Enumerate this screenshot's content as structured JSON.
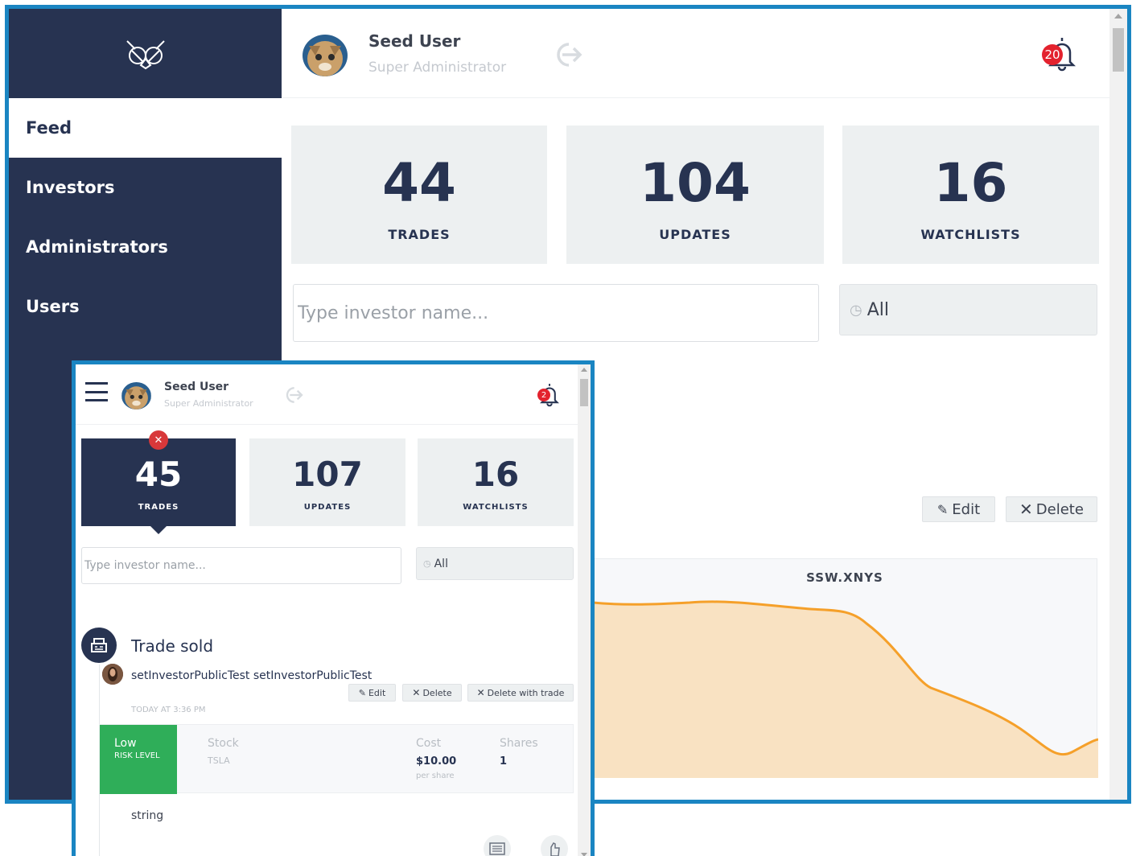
{
  "desktop": {
    "user": {
      "name": "Seed User",
      "role": "Super Administrator"
    },
    "notifications": {
      "count": "20"
    },
    "nav": [
      {
        "label": "Feed",
        "active": true
      },
      {
        "label": "Investors",
        "active": false
      },
      {
        "label": "Administrators",
        "active": false
      },
      {
        "label": "Users",
        "active": false
      }
    ],
    "stats": [
      {
        "value": "44",
        "label": "TRADES"
      },
      {
        "value": "104",
        "label": "UPDATES"
      },
      {
        "value": "16",
        "label": "WATCHLISTS"
      }
    ],
    "search": {
      "placeholder": "Type investor name..."
    },
    "filter": {
      "label": "All"
    },
    "actions": {
      "edit": "Edit",
      "delete": "Delete"
    },
    "chart": {
      "title": "SSW.XNYS"
    }
  },
  "mobile": {
    "user": {
      "name": "Seed User",
      "role": "Super Administrator"
    },
    "notifications": {
      "count": "2"
    },
    "stats": [
      {
        "value": "45",
        "label": "TRADES",
        "selected": true
      },
      {
        "value": "107",
        "label": "UPDATES",
        "selected": false
      },
      {
        "value": "16",
        "label": "WATCHLISTS",
        "selected": false
      }
    ],
    "search": {
      "placeholder": "Type investor name..."
    },
    "filter": {
      "label": "All"
    },
    "feed": {
      "title": "Trade sold",
      "investor": "setInvestorPublicTest setInvestorPublicTest",
      "actions": {
        "edit": "Edit",
        "delete": "Delete",
        "delete_with_trade": "Delete with trade"
      },
      "time": "TODAY AT 3:36 PM",
      "trade": {
        "risk_value": "Low",
        "risk_label": "RISK LEVEL",
        "stock_header": "Stock",
        "stock": "TSLA",
        "cost_header": "Cost",
        "cost": "$10.00",
        "cost_unit": "per share",
        "shares_header": "Shares",
        "shares": "1"
      },
      "note": "string"
    }
  },
  "colors": {
    "navy": "#273351",
    "accent_border": "#1a85c2",
    "risk_low": "#2fae59",
    "badge_red": "#e3222e",
    "chart_line": "#f5a02a",
    "chart_fill": "#f9e2c2"
  }
}
